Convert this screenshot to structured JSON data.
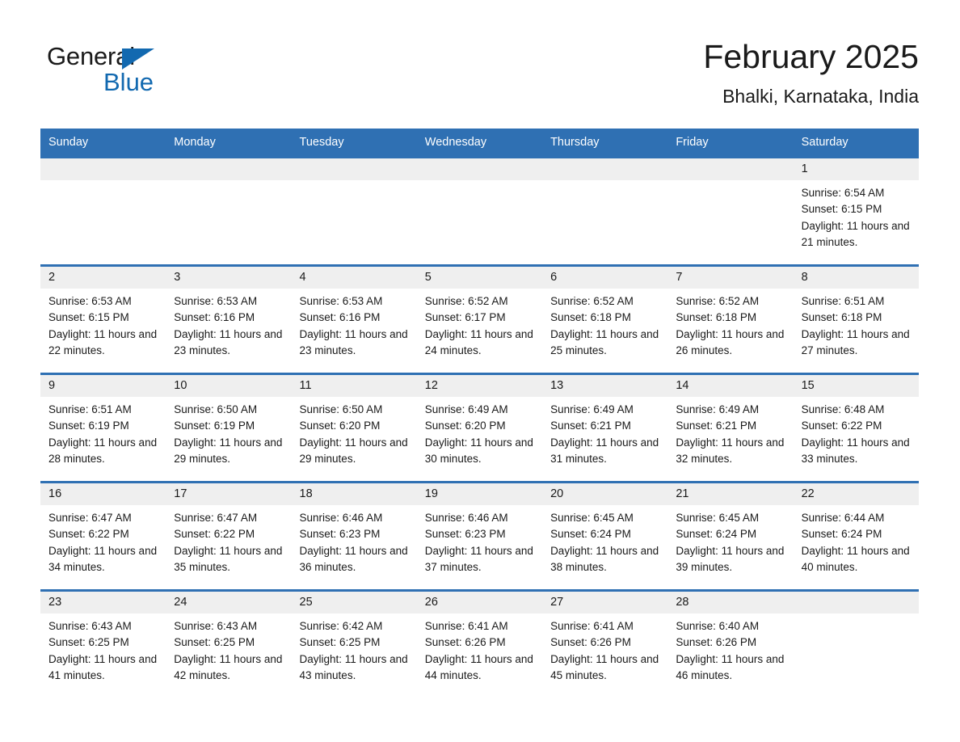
{
  "brand": {
    "name_part1": "General",
    "name_part2": "Blue",
    "logo_icon": "triangle-logo-icon",
    "accent_color": "#1269b0"
  },
  "header": {
    "title": "February 2025",
    "location": "Bhalki, Karnataka, India"
  },
  "theme": {
    "header_blue": "#2f70b3",
    "daynum_band": "#efefef",
    "text": "#1a1a1a"
  },
  "calendar": {
    "weekday_headers": [
      "Sunday",
      "Monday",
      "Tuesday",
      "Wednesday",
      "Thursday",
      "Friday",
      "Saturday"
    ],
    "weeks": [
      [
        {
          "day": "",
          "empty": true
        },
        {
          "day": "",
          "empty": true
        },
        {
          "day": "",
          "empty": true
        },
        {
          "day": "",
          "empty": true
        },
        {
          "day": "",
          "empty": true
        },
        {
          "day": "",
          "empty": true
        },
        {
          "day": "1",
          "sunrise": "Sunrise: 6:54 AM",
          "sunset": "Sunset: 6:15 PM",
          "daylight": "Daylight: 11 hours and 21 minutes."
        }
      ],
      [
        {
          "day": "2",
          "sunrise": "Sunrise: 6:53 AM",
          "sunset": "Sunset: 6:15 PM",
          "daylight": "Daylight: 11 hours and 22 minutes."
        },
        {
          "day": "3",
          "sunrise": "Sunrise: 6:53 AM",
          "sunset": "Sunset: 6:16 PM",
          "daylight": "Daylight: 11 hours and 23 minutes."
        },
        {
          "day": "4",
          "sunrise": "Sunrise: 6:53 AM",
          "sunset": "Sunset: 6:16 PM",
          "daylight": "Daylight: 11 hours and 23 minutes."
        },
        {
          "day": "5",
          "sunrise": "Sunrise: 6:52 AM",
          "sunset": "Sunset: 6:17 PM",
          "daylight": "Daylight: 11 hours and 24 minutes."
        },
        {
          "day": "6",
          "sunrise": "Sunrise: 6:52 AM",
          "sunset": "Sunset: 6:18 PM",
          "daylight": "Daylight: 11 hours and 25 minutes."
        },
        {
          "day": "7",
          "sunrise": "Sunrise: 6:52 AM",
          "sunset": "Sunset: 6:18 PM",
          "daylight": "Daylight: 11 hours and 26 minutes."
        },
        {
          "day": "8",
          "sunrise": "Sunrise: 6:51 AM",
          "sunset": "Sunset: 6:18 PM",
          "daylight": "Daylight: 11 hours and 27 minutes."
        }
      ],
      [
        {
          "day": "9",
          "sunrise": "Sunrise: 6:51 AM",
          "sunset": "Sunset: 6:19 PM",
          "daylight": "Daylight: 11 hours and 28 minutes."
        },
        {
          "day": "10",
          "sunrise": "Sunrise: 6:50 AM",
          "sunset": "Sunset: 6:19 PM",
          "daylight": "Daylight: 11 hours and 29 minutes."
        },
        {
          "day": "11",
          "sunrise": "Sunrise: 6:50 AM",
          "sunset": "Sunset: 6:20 PM",
          "daylight": "Daylight: 11 hours and 29 minutes."
        },
        {
          "day": "12",
          "sunrise": "Sunrise: 6:49 AM",
          "sunset": "Sunset: 6:20 PM",
          "daylight": "Daylight: 11 hours and 30 minutes."
        },
        {
          "day": "13",
          "sunrise": "Sunrise: 6:49 AM",
          "sunset": "Sunset: 6:21 PM",
          "daylight": "Daylight: 11 hours and 31 minutes."
        },
        {
          "day": "14",
          "sunrise": "Sunrise: 6:49 AM",
          "sunset": "Sunset: 6:21 PM",
          "daylight": "Daylight: 11 hours and 32 minutes."
        },
        {
          "day": "15",
          "sunrise": "Sunrise: 6:48 AM",
          "sunset": "Sunset: 6:22 PM",
          "daylight": "Daylight: 11 hours and 33 minutes."
        }
      ],
      [
        {
          "day": "16",
          "sunrise": "Sunrise: 6:47 AM",
          "sunset": "Sunset: 6:22 PM",
          "daylight": "Daylight: 11 hours and 34 minutes."
        },
        {
          "day": "17",
          "sunrise": "Sunrise: 6:47 AM",
          "sunset": "Sunset: 6:22 PM",
          "daylight": "Daylight: 11 hours and 35 minutes."
        },
        {
          "day": "18",
          "sunrise": "Sunrise: 6:46 AM",
          "sunset": "Sunset: 6:23 PM",
          "daylight": "Daylight: 11 hours and 36 minutes."
        },
        {
          "day": "19",
          "sunrise": "Sunrise: 6:46 AM",
          "sunset": "Sunset: 6:23 PM",
          "daylight": "Daylight: 11 hours and 37 minutes."
        },
        {
          "day": "20",
          "sunrise": "Sunrise: 6:45 AM",
          "sunset": "Sunset: 6:24 PM",
          "daylight": "Daylight: 11 hours and 38 minutes."
        },
        {
          "day": "21",
          "sunrise": "Sunrise: 6:45 AM",
          "sunset": "Sunset: 6:24 PM",
          "daylight": "Daylight: 11 hours and 39 minutes."
        },
        {
          "day": "22",
          "sunrise": "Sunrise: 6:44 AM",
          "sunset": "Sunset: 6:24 PM",
          "daylight": "Daylight: 11 hours and 40 minutes."
        }
      ],
      [
        {
          "day": "23",
          "sunrise": "Sunrise: 6:43 AM",
          "sunset": "Sunset: 6:25 PM",
          "daylight": "Daylight: 11 hours and 41 minutes."
        },
        {
          "day": "24",
          "sunrise": "Sunrise: 6:43 AM",
          "sunset": "Sunset: 6:25 PM",
          "daylight": "Daylight: 11 hours and 42 minutes."
        },
        {
          "day": "25",
          "sunrise": "Sunrise: 6:42 AM",
          "sunset": "Sunset: 6:25 PM",
          "daylight": "Daylight: 11 hours and 43 minutes."
        },
        {
          "day": "26",
          "sunrise": "Sunrise: 6:41 AM",
          "sunset": "Sunset: 6:26 PM",
          "daylight": "Daylight: 11 hours and 44 minutes."
        },
        {
          "day": "27",
          "sunrise": "Sunrise: 6:41 AM",
          "sunset": "Sunset: 6:26 PM",
          "daylight": "Daylight: 11 hours and 45 minutes."
        },
        {
          "day": "28",
          "sunrise": "Sunrise: 6:40 AM",
          "sunset": "Sunset: 6:26 PM",
          "daylight": "Daylight: 11 hours and 46 minutes."
        },
        {
          "day": "",
          "empty": true
        }
      ]
    ]
  }
}
